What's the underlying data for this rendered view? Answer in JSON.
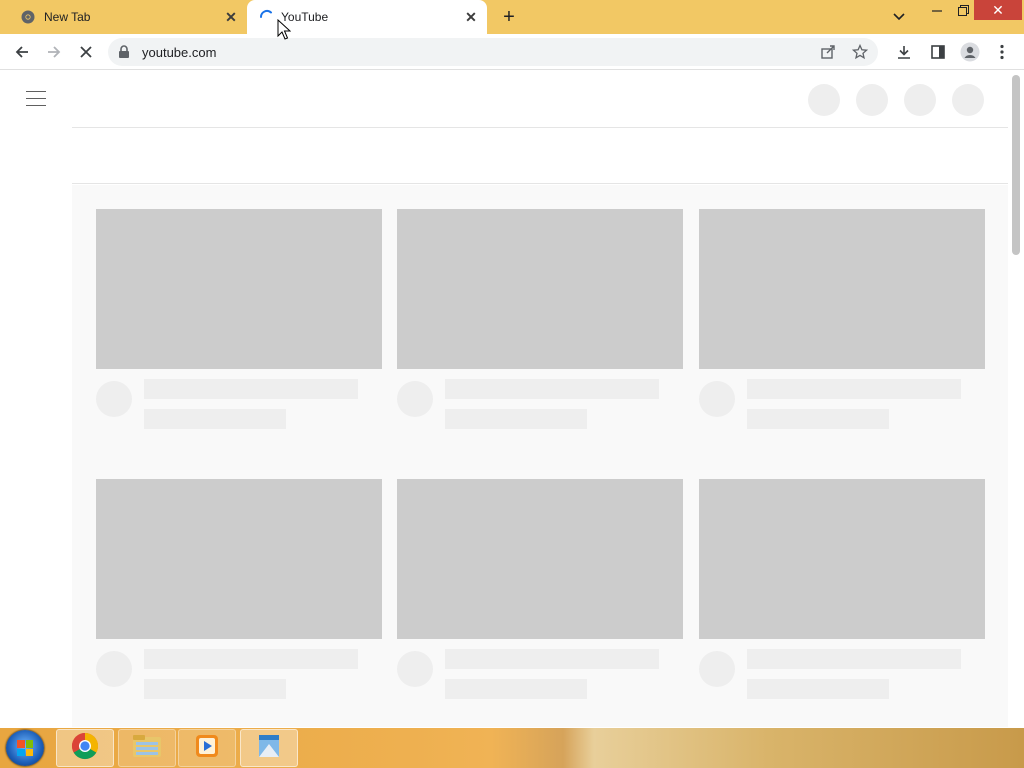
{
  "browser": {
    "tabs": [
      {
        "title": "New Tab",
        "favicon": "chrome-icon",
        "active": false
      },
      {
        "title": "YouTube",
        "favicon": "loading-spinner-icon",
        "active": true
      }
    ],
    "new_tab_label": "+",
    "close_glyph": "✕",
    "address": "youtube.com",
    "colors": {
      "tab_strip": "#f2c864",
      "close_button": "#c9443a"
    }
  },
  "page": {
    "state": "loading skeleton",
    "skeleton_colors": {
      "thumbnail": "#cccccc",
      "placeholder": "#eeeeee",
      "feed_background": "#f9f9f9"
    },
    "header_circles": 4,
    "cards": 6
  },
  "taskbar": {
    "apps": [
      "start-button",
      "chrome-icon",
      "file-explorer-icon",
      "media-player-icon",
      "window-app-icon"
    ]
  }
}
